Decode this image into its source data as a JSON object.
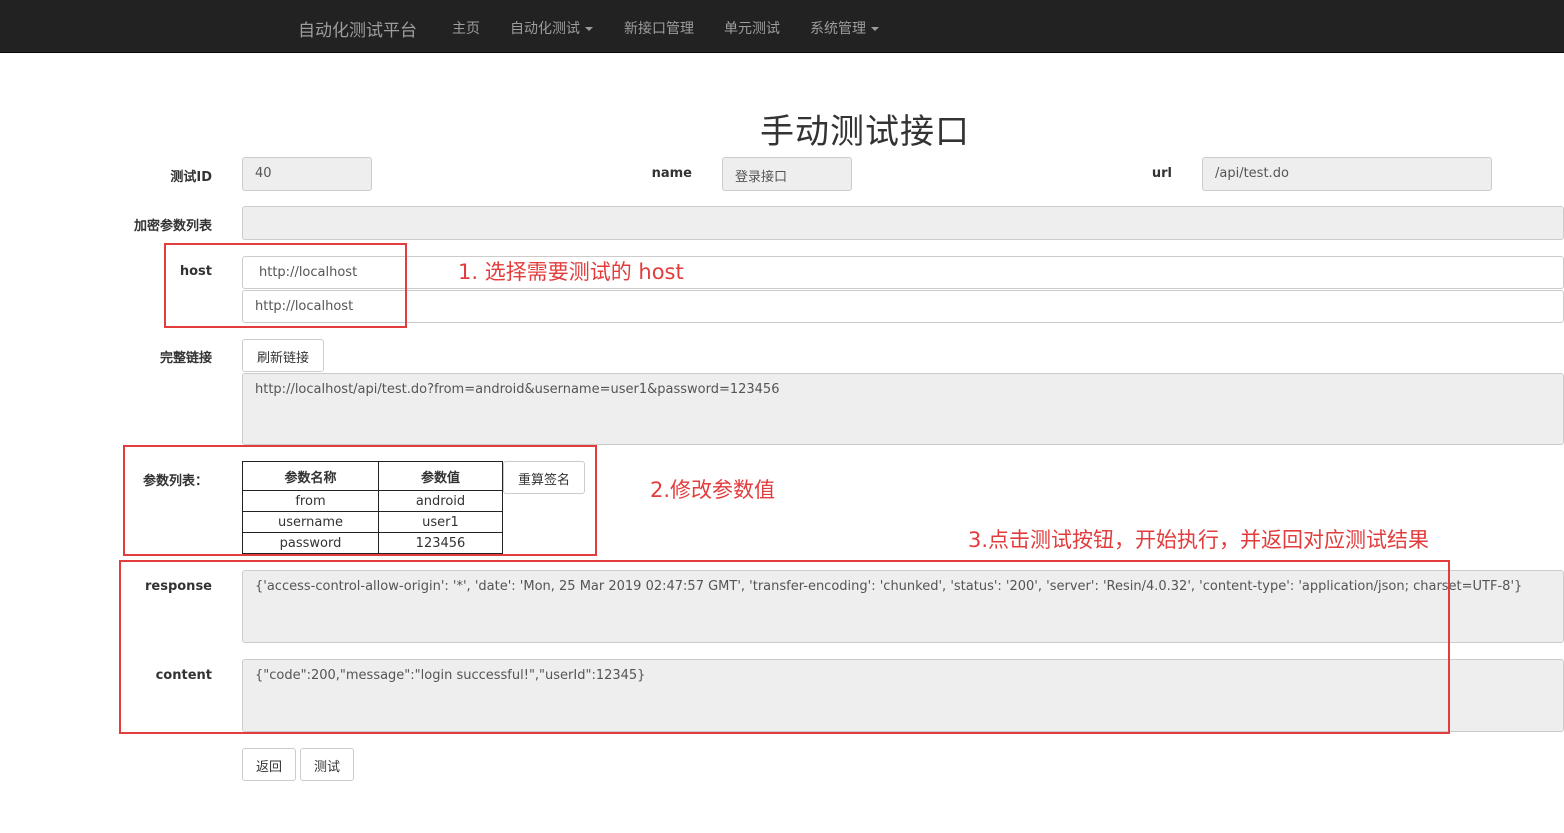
{
  "nav": {
    "brand": "自动化测试平台",
    "items": [
      {
        "label": "主页",
        "dropdown": false
      },
      {
        "label": "自动化测试",
        "dropdown": true
      },
      {
        "label": "新接口管理",
        "dropdown": false
      },
      {
        "label": "单元测试",
        "dropdown": false
      },
      {
        "label": "系统管理",
        "dropdown": true
      }
    ]
  },
  "page": {
    "title": "手动测试接口"
  },
  "form": {
    "test_id": {
      "label": "测试ID",
      "value": "40"
    },
    "name": {
      "label": "name",
      "value": "登录接口"
    },
    "url": {
      "label": "url",
      "value": "/api/test.do"
    },
    "encrypt_params": {
      "label": "加密参数列表",
      "value": ""
    },
    "host": {
      "label": "host",
      "selected": "http://localhost",
      "value": "http://localhost"
    },
    "full_link": {
      "label": "完整链接",
      "refresh_button": "刷新链接",
      "value": "http://localhost/api/test.do?from=android&username=user1&password=123456"
    },
    "params": {
      "label": "参数列表：",
      "headers": [
        "参数名称",
        "参数值"
      ],
      "rows": [
        [
          "from",
          "android"
        ],
        [
          "username",
          "user1"
        ],
        [
          "password",
          "123456"
        ]
      ],
      "resign_button": "重算签名"
    },
    "response": {
      "label": "response",
      "value": "{'access-control-allow-origin': '*', 'date': 'Mon, 25 Mar 2019 02:47:57 GMT', 'transfer-encoding': 'chunked', 'status': '200', 'server': 'Resin/4.0.32', 'content-type': 'application/json; charset=UTF-8'}"
    },
    "content": {
      "label": "content",
      "value": "{\"code\":200,\"message\":\"login successful!\",\"userId\":12345}"
    },
    "back_button": "返回",
    "test_button": "测试"
  },
  "annotations": {
    "step1": "1. 选择需要测试的 host",
    "step2": "2.修改参数值",
    "step3": "3.点击测试按钮，开始执行，并返回对应测试结果"
  },
  "colors": {
    "navbar": "#222222",
    "annotation": "#e23c3c",
    "readonly_field": "#eeeeee"
  }
}
